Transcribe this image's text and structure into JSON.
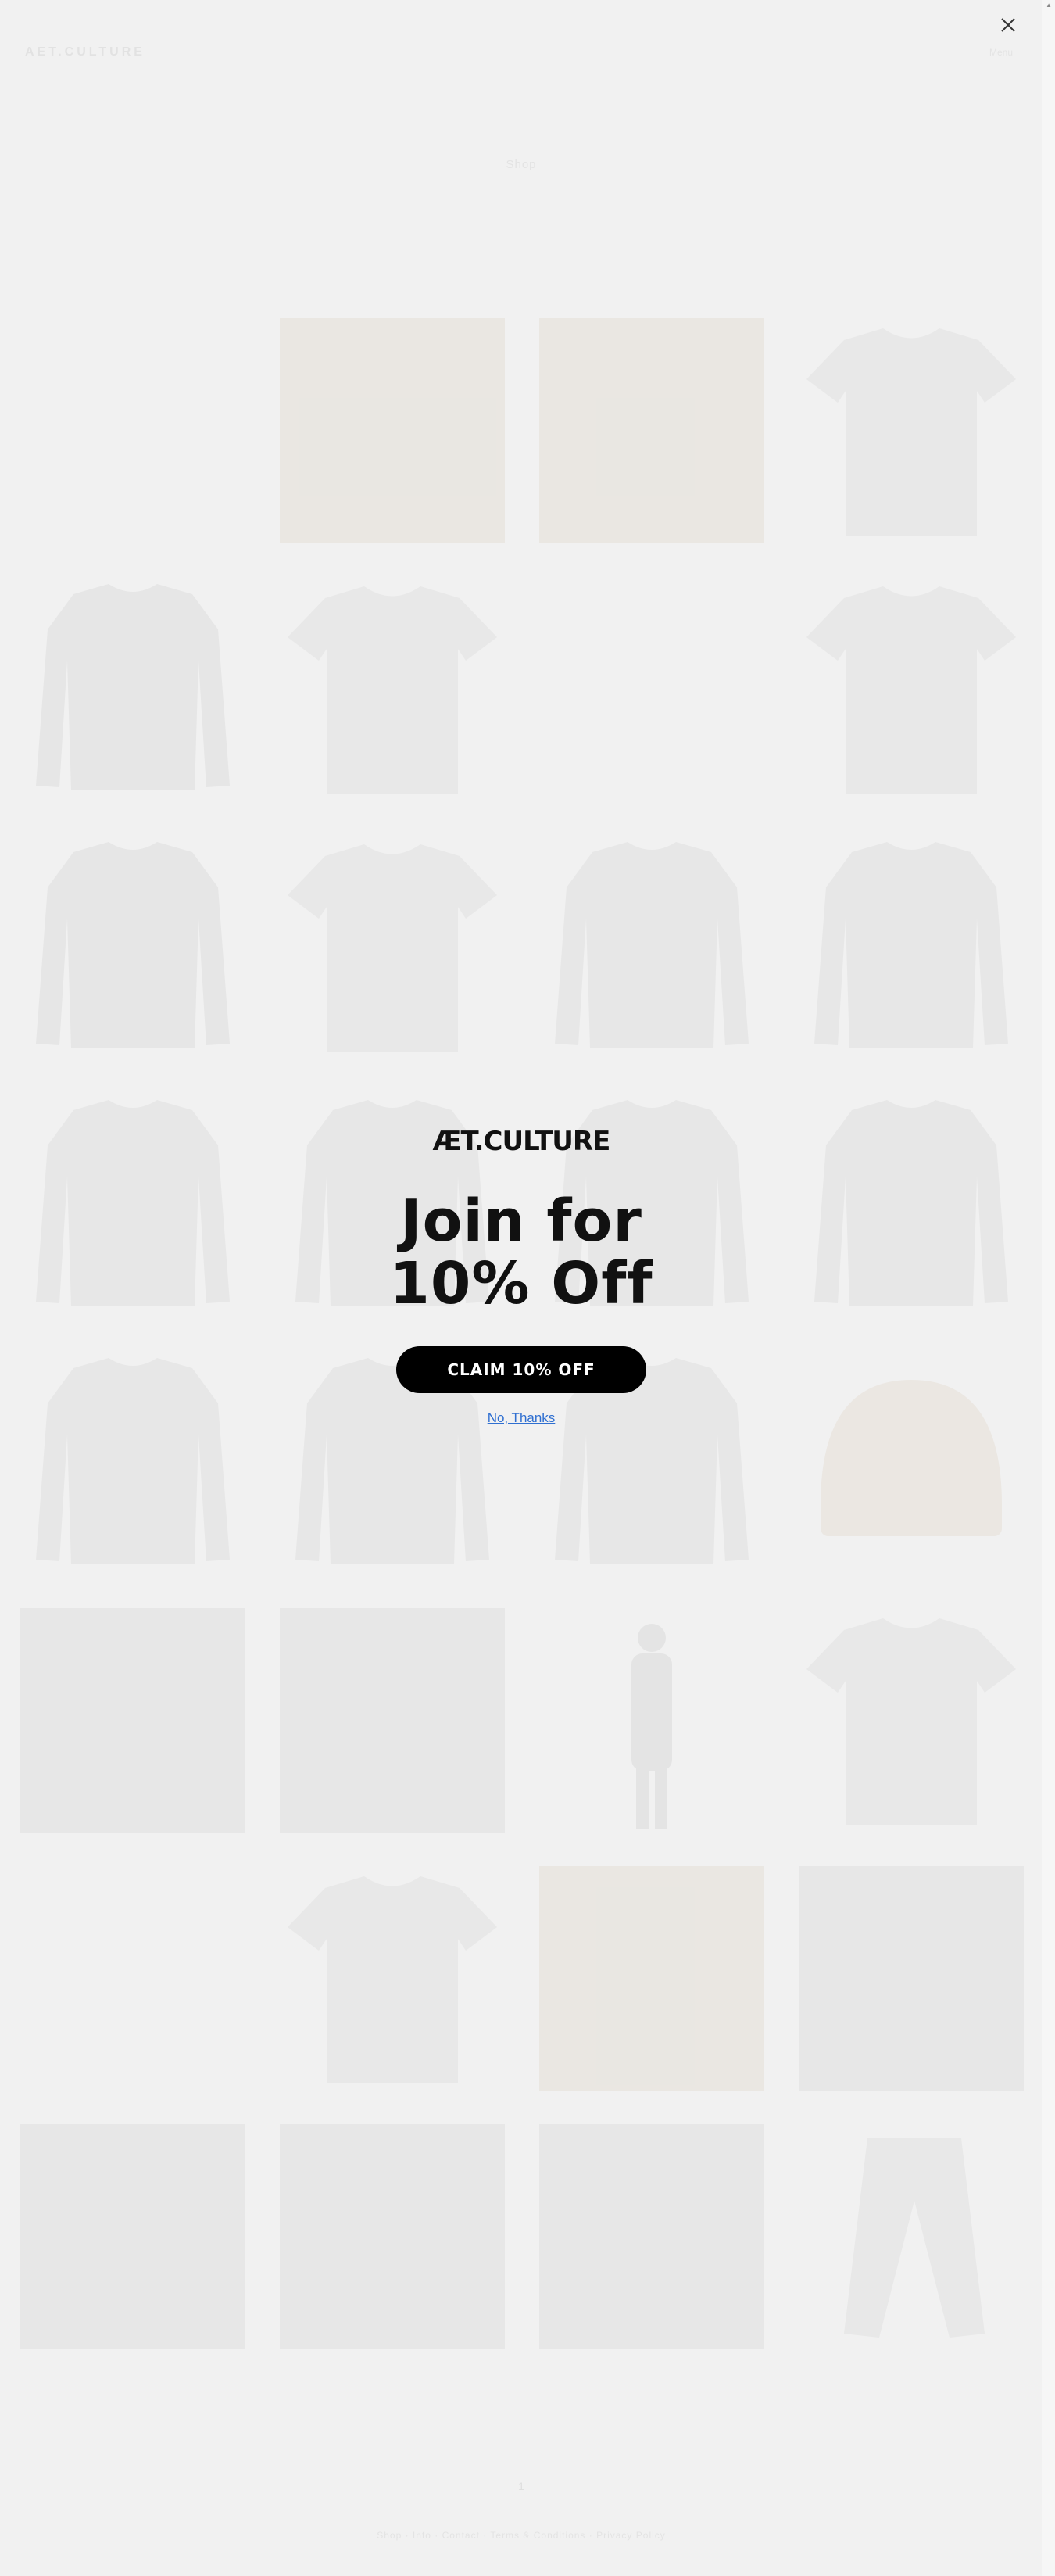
{
  "header": {
    "brand": "AET.CULTURE",
    "menu_label": "Menu"
  },
  "collection": {
    "title": "Shop"
  },
  "products": [
    {
      "icon": "gift-card-icon"
    },
    {
      "icon": "print-icon"
    },
    {
      "icon": "print-icon"
    },
    {
      "icon": "tshirt-icon"
    },
    {
      "icon": "sweater-icon"
    },
    {
      "icon": "tshirt-icon"
    },
    {
      "icon": "blank-icon"
    },
    {
      "icon": "tshirt-icon"
    },
    {
      "icon": "sweater-icon"
    },
    {
      "icon": "tshirt-icon"
    },
    {
      "icon": "longsleeve-icon"
    },
    {
      "icon": "longsleeve-icon"
    },
    {
      "icon": "longsleeve-icon"
    },
    {
      "icon": "longsleeve-icon"
    },
    {
      "icon": "longsleeve-icon"
    },
    {
      "icon": "longsleeve-icon"
    },
    {
      "icon": "longsleeve-icon"
    },
    {
      "icon": "longsleeve-icon"
    },
    {
      "icon": "longsleeve-icon"
    },
    {
      "icon": "beanie-icon"
    },
    {
      "icon": "photo-icon"
    },
    {
      "icon": "photo-icon"
    },
    {
      "icon": "figure-icon"
    },
    {
      "icon": "tshirt-icon"
    },
    {
      "icon": "blank-icon"
    },
    {
      "icon": "tshirt-icon"
    },
    {
      "icon": "print-icon"
    },
    {
      "icon": "photo-icon"
    },
    {
      "icon": "photo-icon"
    },
    {
      "icon": "photo-icon"
    },
    {
      "icon": "photo-icon"
    },
    {
      "icon": "pants-icon"
    }
  ],
  "pagination": {
    "current": "1"
  },
  "footer": {
    "links": "Shop  ·  Info  ·  Contact  ·  Terms & Conditions  ·  Privacy Policy"
  },
  "popup": {
    "logo": "ÆT.CULTURE",
    "title_line1": "Join for",
    "title_line2": "10% Off",
    "claim_label": "CLAIM 10% OFF",
    "decline_label": "No, Thanks",
    "close_icon": "close-icon"
  },
  "colors": {
    "page_bg": "#f1f1f1",
    "button_bg": "#000000",
    "link": "#2f6fd1"
  }
}
